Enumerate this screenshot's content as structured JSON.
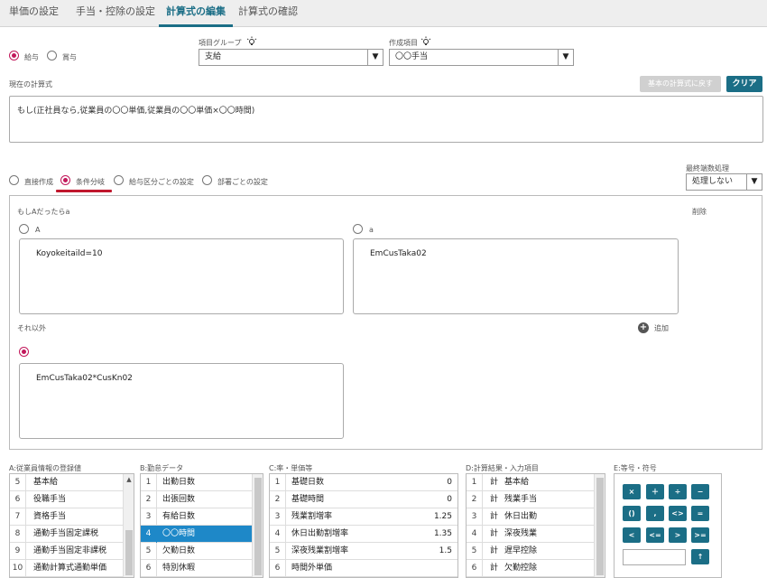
{
  "tabs": [
    "単価の設定",
    "手当・控除の設定",
    "計算式の編集",
    "計算式の確認"
  ],
  "pay_type": {
    "options": [
      "給与",
      "賞与"
    ],
    "selected": "給与"
  },
  "item_group": {
    "label": "項目グループ",
    "value": "支給"
  },
  "create_item": {
    "label": "作成項目",
    "value": "〇〇手当"
  },
  "current_formula": {
    "label": "現在の計算式",
    "value": "もし(正社員なら,従業員の〇〇単価,従業員の〇〇単価×〇〇時間)"
  },
  "buttons": {
    "reset": "基本の計算式に戻す",
    "clear": "クリア",
    "delete": "削除",
    "add": "追加"
  },
  "mode": {
    "options": [
      "直接作成",
      "条件分岐",
      "給与区分ごとの設定",
      "部署ごとの設定"
    ],
    "selected": "条件分岐"
  },
  "rounding": {
    "label": "最終端数処理",
    "value": "処理しない"
  },
  "condition": {
    "header": "もしAだったらa",
    "a_label": "A",
    "a_value": "Koyokeitaild=10",
    "b_label": "a",
    "b_value": "EmCusTaka02",
    "else_label": "それ以外",
    "else_value": "EmCusTaka02*CusKn02"
  },
  "lists": {
    "a": {
      "title": "A:従業員情報の登録値",
      "rows": [
        {
          "n": "5",
          "t": "基本給"
        },
        {
          "n": "6",
          "t": "役職手当"
        },
        {
          "n": "7",
          "t": "資格手当"
        },
        {
          "n": "8",
          "t": "通勤手当固定課税"
        },
        {
          "n": "9",
          "t": "通勤手当固定非課税"
        },
        {
          "n": "10",
          "t": "通勤計算式通勤単価"
        }
      ]
    },
    "b": {
      "title": "B:勤怠データ",
      "rows": [
        {
          "n": "1",
          "t": "出勤日数"
        },
        {
          "n": "2",
          "t": "出張回数"
        },
        {
          "n": "3",
          "t": "有給日数"
        },
        {
          "n": "4",
          "t": "〇〇時間"
        },
        {
          "n": "5",
          "t": "欠勤日数"
        },
        {
          "n": "6",
          "t": "特別休暇"
        }
      ],
      "selected": "4"
    },
    "c": {
      "title": "C:率・単価等",
      "rows": [
        {
          "n": "1",
          "t": "基礎日数",
          "v": "0"
        },
        {
          "n": "2",
          "t": "基礎時間",
          "v": "0"
        },
        {
          "n": "3",
          "t": "残業割増率",
          "v": "1.25"
        },
        {
          "n": "4",
          "t": "休日出勤割増率",
          "v": "1.35"
        },
        {
          "n": "5",
          "t": "深夜残業割増率",
          "v": "1.5"
        },
        {
          "n": "6",
          "t": "時間外単価",
          "v": ""
        }
      ]
    },
    "d": {
      "title": "D:計算結果・入力項目",
      "rows": [
        {
          "n": "1",
          "c": "計",
          "t": "基本給"
        },
        {
          "n": "2",
          "c": "計",
          "t": "残業手当"
        },
        {
          "n": "3",
          "c": "計",
          "t": "休日出勤"
        },
        {
          "n": "4",
          "c": "計",
          "t": "深夜残業"
        },
        {
          "n": "5",
          "c": "計",
          "t": "遅早控除"
        },
        {
          "n": "6",
          "c": "計",
          "t": "欠勤控除"
        }
      ]
    }
  },
  "calculator": {
    "title": "E:等号・符号",
    "keys": [
      "×",
      "＋",
      "÷",
      "−",
      "()",
      ",",
      "<>",
      "=",
      "<",
      "<=",
      ">",
      ">="
    ],
    "enter": "↑"
  },
  "colors": {
    "accent": "#1b6e86",
    "radio_on": "#c2185b",
    "selected_row": "#1e88c8"
  }
}
